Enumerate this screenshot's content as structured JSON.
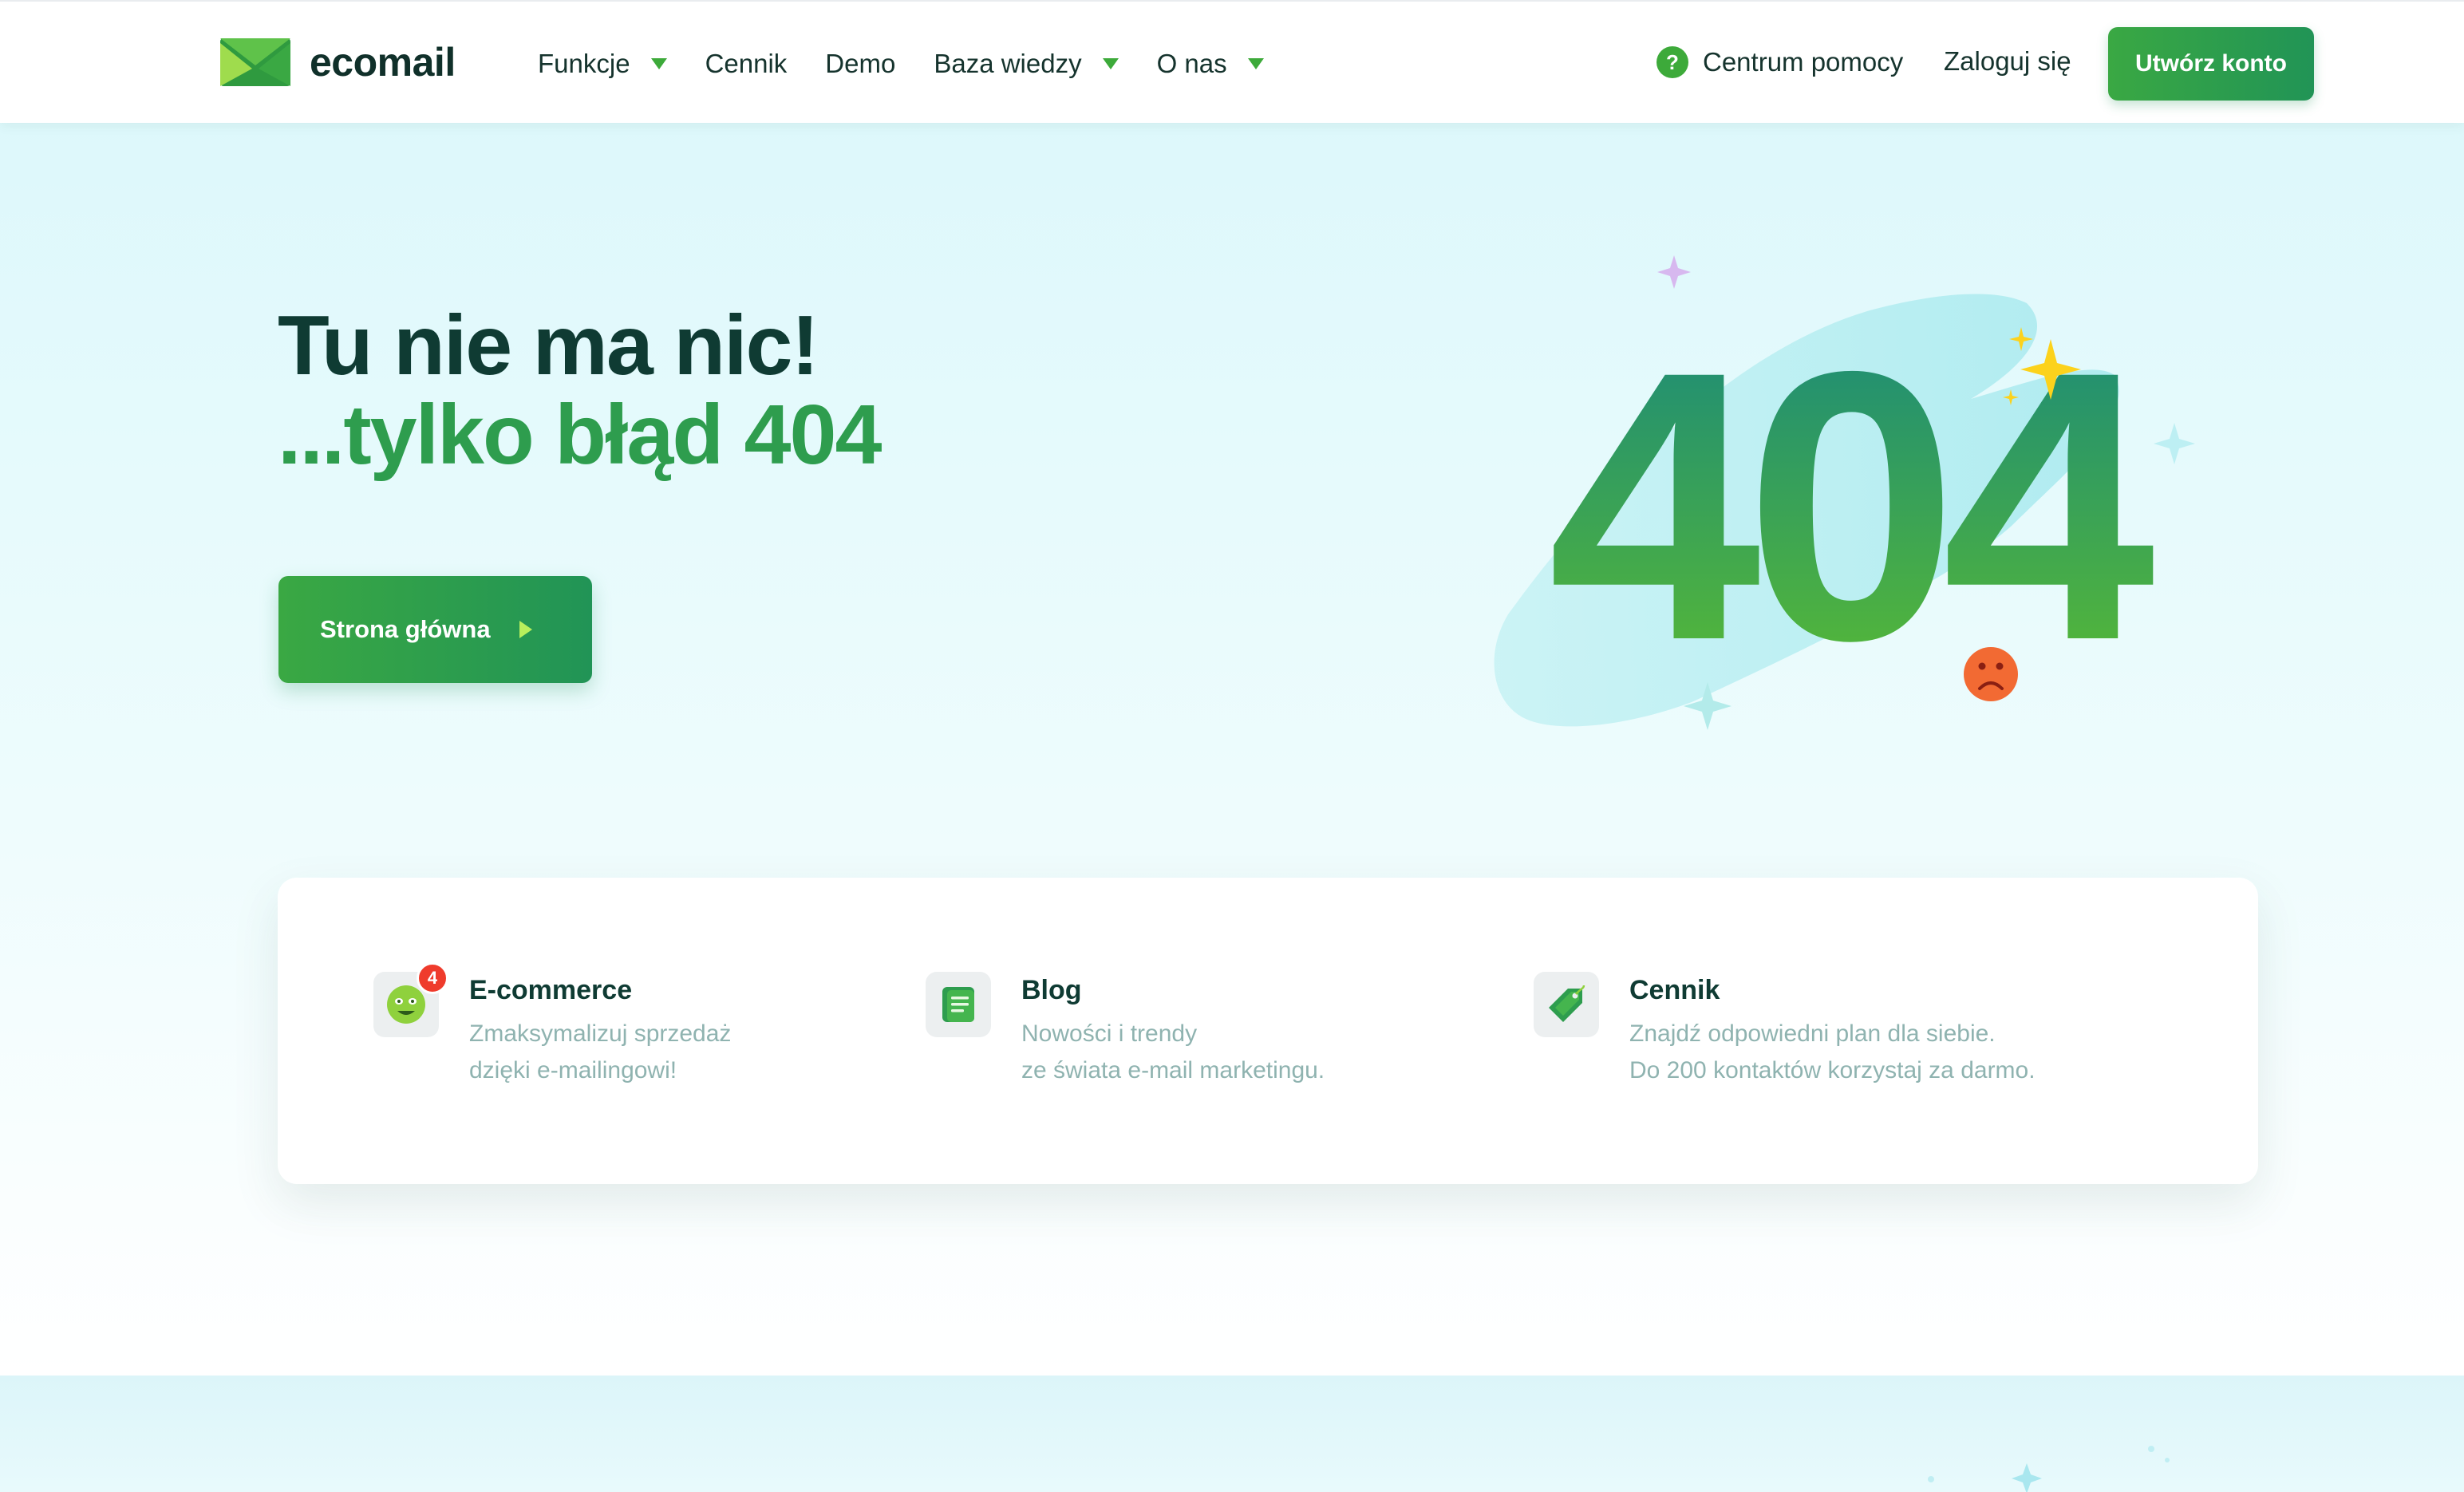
{
  "brand": {
    "name": "ecomail"
  },
  "nav": {
    "items": [
      {
        "label": "Funkcje",
        "has_dropdown": true
      },
      {
        "label": "Cennik",
        "has_dropdown": false
      },
      {
        "label": "Demo",
        "has_dropdown": false
      },
      {
        "label": "Baza wiedzy",
        "has_dropdown": true
      },
      {
        "label": "O nas",
        "has_dropdown": true
      }
    ],
    "help_label": "Centrum pomocy",
    "help_icon": "question-icon",
    "login_label": "Zaloguj się",
    "cta_label": "Utwórz konto"
  },
  "hero": {
    "title_line1": "Tu nie ma nic!",
    "title_line2": "...tylko błąd 404",
    "home_button_label": "Strona główna",
    "illustration_text": "404"
  },
  "cards": [
    {
      "title": "E-commerce",
      "desc_line1": "Zmaksymalizuj sprzedaż",
      "desc_line2": "dzięki e-mailingowi!",
      "badge": "4",
      "icon": "smiley-icon"
    },
    {
      "title": "Blog",
      "desc_line1": "Nowości i trendy",
      "desc_line2": "ze świata e-mail marketingu.",
      "icon": "document-icon"
    },
    {
      "title": "Cennik",
      "desc_line1": "Znajdź odpowiedni plan dla siebie.",
      "desc_line2": "Do 200 kontaktów korzystaj za darmo.",
      "icon": "price-tag-icon"
    }
  ],
  "colors": {
    "brand_green": "#3daa3a",
    "dark_text": "#0f3b33",
    "accent_green": "#2e9d4e",
    "muted_text": "#8fb3b0",
    "hero_bg": "#ddf8fb"
  }
}
